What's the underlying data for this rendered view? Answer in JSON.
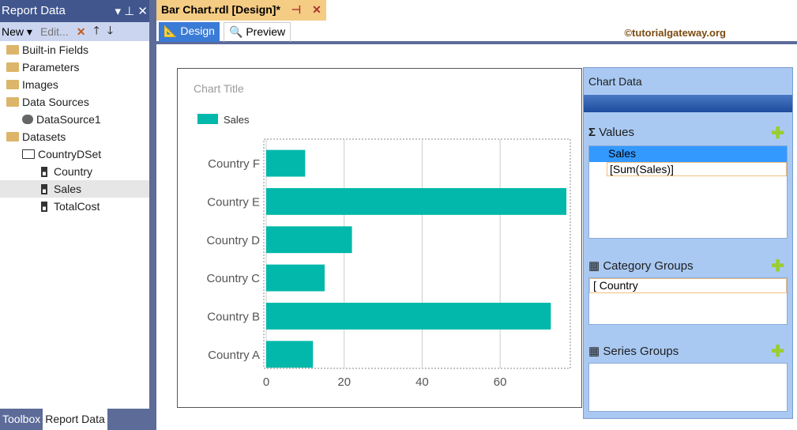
{
  "left_panel": {
    "title": "Report Data",
    "toolbar": {
      "new": "New",
      "edit": "Edit..."
    },
    "tree": [
      {
        "label": "Built-in Fields",
        "type": "folder"
      },
      {
        "label": "Parameters",
        "type": "folder"
      },
      {
        "label": "Images",
        "type": "folder"
      },
      {
        "label": "Data Sources",
        "type": "folder"
      },
      {
        "label": "DataSource1",
        "type": "datasource"
      },
      {
        "label": "Datasets",
        "type": "folder"
      },
      {
        "label": "CountryDSet",
        "type": "dataset"
      },
      {
        "label": "Country",
        "type": "field"
      },
      {
        "label": "Sales",
        "type": "field"
      },
      {
        "label": "TotalCost",
        "type": "field"
      }
    ],
    "bottom_tabs": [
      "Toolbox",
      "Report Data"
    ]
  },
  "document": {
    "tab_title": "Bar Chart.rdl [Design]*",
    "views": [
      "Design",
      "Preview"
    ],
    "credit": "©tutorialgateway.org"
  },
  "chart_pane": {
    "title": "Chart Data",
    "values_label": "Values",
    "value_item": "Sales",
    "value_expr": "[Sum(Sales)]",
    "category_label": "Category Groups",
    "category_item": "Country",
    "series_label": "Series Groups"
  },
  "chart_data": {
    "type": "bar",
    "orientation": "horizontal",
    "title": "Chart Title",
    "legend": [
      "Sales"
    ],
    "categories": [
      "Country F",
      "Country E",
      "Country D",
      "Country C",
      "Country B",
      "Country A"
    ],
    "values": [
      10,
      77,
      22,
      15,
      73,
      12
    ],
    "xticks": [
      0,
      20,
      40,
      60
    ],
    "xlim": [
      0,
      78
    ],
    "color": "#01b8aa"
  }
}
